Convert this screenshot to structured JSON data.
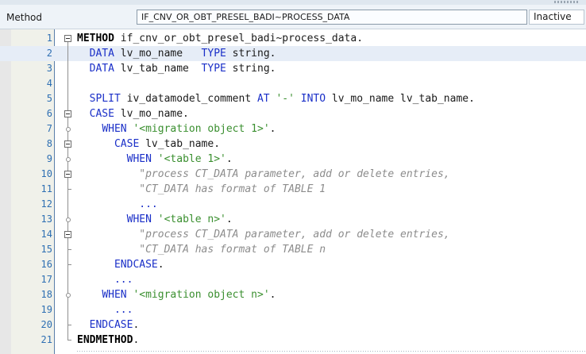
{
  "header": {
    "label": "Method",
    "method_name": "IF_CNV_OR_OBT_PRESEL_BADI~PROCESS_DATA",
    "status": "Inactive"
  },
  "editor": {
    "current_line": 2,
    "lines": [
      {
        "num": "1",
        "fold": "box-top",
        "tokens": [
          {
            "t": "METHOD",
            "c": "kwb"
          },
          {
            "t": " if_cnv_or_obt_presel_badi~process_data.",
            "c": ""
          }
        ]
      },
      {
        "num": "2",
        "fold": "bar",
        "tokens": [
          {
            "t": "  ",
            "c": ""
          },
          {
            "t": "DATA",
            "c": "kw"
          },
          {
            "t": " lv_mo_name   ",
            "c": ""
          },
          {
            "t": "TYPE",
            "c": "kw"
          },
          {
            "t": " string.",
            "c": ""
          }
        ]
      },
      {
        "num": "3",
        "fold": "bar",
        "tokens": [
          {
            "t": "  ",
            "c": ""
          },
          {
            "t": "DATA",
            "c": "kw"
          },
          {
            "t": " lv_tab_name  ",
            "c": ""
          },
          {
            "t": "TYPE",
            "c": "kw"
          },
          {
            "t": " string.",
            "c": ""
          }
        ]
      },
      {
        "num": "4",
        "fold": "bar",
        "tokens": []
      },
      {
        "num": "5",
        "fold": "bar",
        "tokens": [
          {
            "t": "  ",
            "c": ""
          },
          {
            "t": "SPLIT",
            "c": "kw"
          },
          {
            "t": " iv_datamodel_comment ",
            "c": ""
          },
          {
            "t": "AT",
            "c": "kw"
          },
          {
            "t": " ",
            "c": ""
          },
          {
            "t": "'-'",
            "c": "str"
          },
          {
            "t": " ",
            "c": ""
          },
          {
            "t": "INTO",
            "c": "kw"
          },
          {
            "t": " lv_mo_name lv_tab_name.",
            "c": ""
          }
        ]
      },
      {
        "num": "6",
        "fold": "box",
        "tokens": [
          {
            "t": "  ",
            "c": ""
          },
          {
            "t": "CASE",
            "c": "kw"
          },
          {
            "t": " lv_mo_name.",
            "c": ""
          }
        ]
      },
      {
        "num": "7",
        "fold": "dot",
        "tokens": [
          {
            "t": "    ",
            "c": ""
          },
          {
            "t": "WHEN",
            "c": "kw"
          },
          {
            "t": " ",
            "c": ""
          },
          {
            "t": "'<migration object 1>'",
            "c": "str"
          },
          {
            "t": ".",
            "c": ""
          }
        ]
      },
      {
        "num": "8",
        "fold": "box",
        "tokens": [
          {
            "t": "      ",
            "c": ""
          },
          {
            "t": "CASE",
            "c": "kw"
          },
          {
            "t": " lv_tab_name.",
            "c": ""
          }
        ]
      },
      {
        "num": "9",
        "fold": "dot",
        "tokens": [
          {
            "t": "        ",
            "c": ""
          },
          {
            "t": "WHEN",
            "c": "kw"
          },
          {
            "t": " ",
            "c": ""
          },
          {
            "t": "'<table 1>'",
            "c": "str"
          },
          {
            "t": ".",
            "c": ""
          }
        ]
      },
      {
        "num": "10",
        "fold": "box",
        "tokens": [
          {
            "t": "          ",
            "c": ""
          },
          {
            "t": "\"process CT_DATA parameter, add or delete entries,",
            "c": "cmt"
          }
        ]
      },
      {
        "num": "11",
        "fold": "tick",
        "tokens": [
          {
            "t": "          ",
            "c": ""
          },
          {
            "t": "\"CT_DATA has format of TABLE 1",
            "c": "cmt"
          }
        ]
      },
      {
        "num": "12",
        "fold": "bar",
        "tokens": [
          {
            "t": "          ",
            "c": ""
          },
          {
            "t": "...",
            "c": "kw"
          }
        ]
      },
      {
        "num": "13",
        "fold": "dot",
        "tokens": [
          {
            "t": "        ",
            "c": ""
          },
          {
            "t": "WHEN",
            "c": "kw"
          },
          {
            "t": " ",
            "c": ""
          },
          {
            "t": "'<table n>'",
            "c": "str"
          },
          {
            "t": ".",
            "c": ""
          }
        ]
      },
      {
        "num": "14",
        "fold": "box",
        "tokens": [
          {
            "t": "          ",
            "c": ""
          },
          {
            "t": "\"process CT_DATA parameter, add or delete entries,",
            "c": "cmt"
          }
        ]
      },
      {
        "num": "15",
        "fold": "tick",
        "tokens": [
          {
            "t": "          ",
            "c": ""
          },
          {
            "t": "\"CT_DATA has format of TABLE n",
            "c": "cmt"
          }
        ]
      },
      {
        "num": "16",
        "fold": "tick",
        "tokens": [
          {
            "t": "      ",
            "c": ""
          },
          {
            "t": "ENDCASE",
            "c": "kw"
          },
          {
            "t": ".",
            "c": ""
          }
        ]
      },
      {
        "num": "17",
        "fold": "bar",
        "tokens": [
          {
            "t": "      ",
            "c": ""
          },
          {
            "t": "...",
            "c": "kw"
          }
        ]
      },
      {
        "num": "18",
        "fold": "dot",
        "tokens": [
          {
            "t": "    ",
            "c": ""
          },
          {
            "t": "WHEN",
            "c": "kw"
          },
          {
            "t": " ",
            "c": ""
          },
          {
            "t": "'<migration object n>'",
            "c": "str"
          },
          {
            "t": ".",
            "c": ""
          }
        ]
      },
      {
        "num": "19",
        "fold": "bar",
        "tokens": [
          {
            "t": "      ",
            "c": ""
          },
          {
            "t": "...",
            "c": "kw"
          }
        ]
      },
      {
        "num": "20",
        "fold": "tick",
        "tokens": [
          {
            "t": "  ",
            "c": ""
          },
          {
            "t": "ENDCASE",
            "c": "kw"
          },
          {
            "t": ".",
            "c": ""
          }
        ]
      },
      {
        "num": "21",
        "fold": "end",
        "tokens": [
          {
            "t": "ENDMETHOD",
            "c": "kwb"
          },
          {
            "t": ".",
            "c": ""
          }
        ]
      }
    ]
  },
  "colors": {
    "keyword": "#1a2fc8",
    "string": "#3a8f2f",
    "comment": "#8c8c8c",
    "line_number": "#2e6fb3",
    "current_line_bg": "#e6edf7"
  }
}
